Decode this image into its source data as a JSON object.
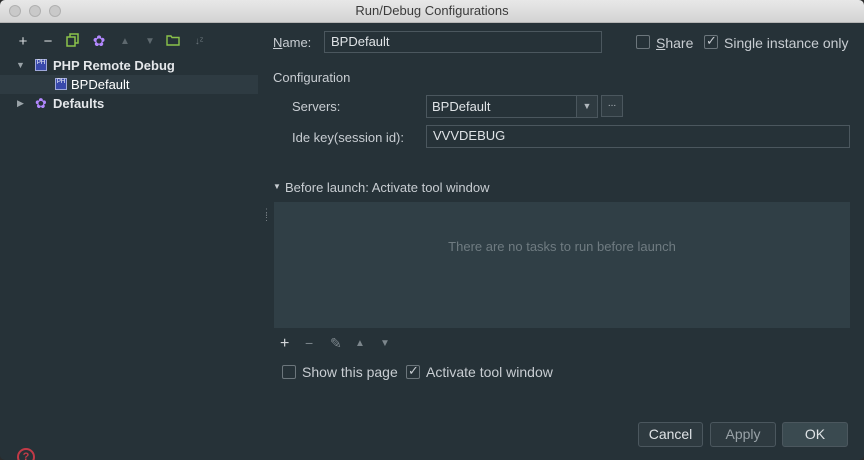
{
  "window": {
    "title": "Run/Debug Configurations"
  },
  "sidebar": {
    "toolbar": [
      "add-icon",
      "remove-icon",
      "copy-icon",
      "settings-icon",
      "move-up-icon",
      "move-down-icon",
      "folder-icon",
      "sort-icon"
    ],
    "tree": [
      {
        "label": "PHP Remote Debug",
        "expanded": true
      },
      {
        "label": "BPDefault",
        "selected": true
      },
      {
        "label": "Defaults",
        "expanded": false
      }
    ]
  },
  "form": {
    "name_label": "Name:",
    "name_value": "BPDefault",
    "share_label": "Share",
    "share_checked": false,
    "single_instance_label": "Single instance only",
    "single_instance_checked": true,
    "configuration_heading": "Configuration",
    "servers_label": "Servers:",
    "servers_value": "BPDefault",
    "ellipsis_label": "...",
    "idekey_label": "Ide key(session id):",
    "idekey_value": "VVVDEBUG"
  },
  "before_launch": {
    "heading": "Before launch: Activate tool window",
    "empty_text": "There are no tasks to run before launch",
    "show_page_label": "Show this page",
    "show_page_checked": false,
    "activate_label": "Activate tool window",
    "activate_checked": true
  },
  "footer": {
    "cancel": "Cancel",
    "apply": "Apply",
    "ok": "OK",
    "help": "?"
  }
}
